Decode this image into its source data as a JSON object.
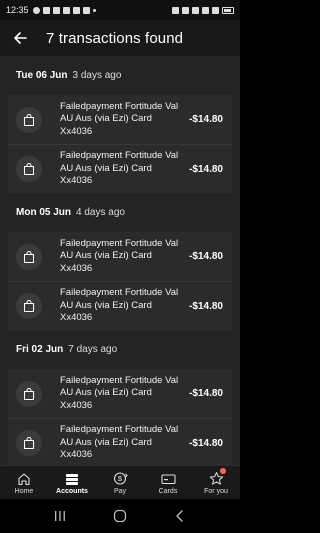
{
  "status_bar": {
    "time": "12:35",
    "left_icons": [
      "whatsapp-icon",
      "image-icon",
      "tiktok-icon",
      "tiktok-icon",
      "s-app-icon",
      "assistant-icon",
      "dot-icon"
    ],
    "right_icons": [
      "alarm-icon",
      "mute-icon",
      "wifi-icon",
      "volte-icon",
      "signal-icon",
      "battery-icon"
    ]
  },
  "app_bar": {
    "title": "7 transactions found",
    "back_icon": "arrow-left-icon"
  },
  "sections": [
    {
      "date": "Tue 06 Jun",
      "ago": "3 days ago",
      "transactions": [
        {
          "description": "Failedpayment Fortitude Val AU Aus (via Ezi) Card Xx4036",
          "amount": "-$14.80",
          "icon": "shopping-bag-icon"
        },
        {
          "description": "Failedpayment Fortitude Val AU Aus (via Ezi) Card Xx4036",
          "amount": "-$14.80",
          "icon": "shopping-bag-icon"
        }
      ]
    },
    {
      "date": "Mon 05 Jun",
      "ago": "4 days ago",
      "transactions": [
        {
          "description": "Failedpayment Fortitude Val AU Aus (via Ezi) Card Xx4036",
          "amount": "-$14.80",
          "icon": "shopping-bag-icon"
        },
        {
          "description": "Failedpayment Fortitude Val AU Aus (via Ezi) Card Xx4036",
          "amount": "-$14.80",
          "icon": "shopping-bag-icon"
        }
      ]
    },
    {
      "date": "Fri 02 Jun",
      "ago": "7 days ago",
      "transactions": [
        {
          "description": "Failedpayment Fortitude Val AU Aus (via Ezi) Card Xx4036",
          "amount": "-$14.80",
          "icon": "shopping-bag-icon"
        },
        {
          "description": "Failedpayment Fortitude Val AU Aus (via Ezi) Card Xx4036",
          "amount": "-$14.80",
          "icon": "shopping-bag-icon"
        }
      ]
    }
  ],
  "bottom_nav": [
    {
      "label": "Home",
      "icon": "home-icon",
      "active": false
    },
    {
      "label": "Accounts",
      "icon": "accounts-icon",
      "active": true
    },
    {
      "label": "Pay",
      "icon": "pay-icon",
      "active": false
    },
    {
      "label": "Cards",
      "icon": "card-icon",
      "active": false
    },
    {
      "label": "For you",
      "icon": "star-icon",
      "active": false,
      "badge": true
    }
  ],
  "system_nav": [
    "recents-icon",
    "home-circle-icon",
    "back-chevron-icon"
  ],
  "colors": {
    "background": "#252323",
    "card": "#2c2a2a",
    "app_bar": "#1a1919",
    "badge": "#ff6a4d"
  }
}
